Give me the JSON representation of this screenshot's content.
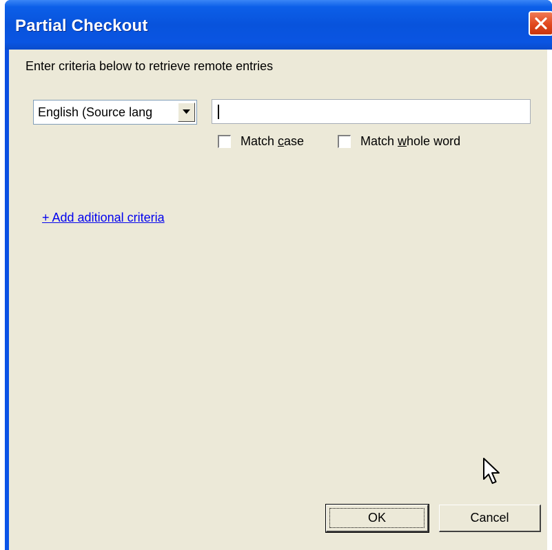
{
  "window": {
    "title": "Partial Checkout"
  },
  "dialog": {
    "instructions": "Enter criteria below to retrieve remote entries",
    "language_select": {
      "value": "English (Source lang"
    },
    "search": {
      "value": ""
    },
    "checkboxes": {
      "match_case": {
        "label_pre": "Match ",
        "mnemonic": "c",
        "label_post": "ase",
        "checked": false
      },
      "match_whole_word": {
        "label_pre": "Match ",
        "mnemonic": "w",
        "label_post": "hole word",
        "checked": false
      }
    },
    "add_criteria_link": "+ Add aditional criteria",
    "buttons": {
      "ok": "OK",
      "cancel": "Cancel"
    }
  },
  "colors": {
    "title_bar": "#0a54e2",
    "client_bg": "#ece9d8",
    "link": "#0000ee",
    "close_button": "#e1471d"
  },
  "icons": {
    "close": "close-icon",
    "dropdown": "chevron-down-icon",
    "cursor": "mouse-pointer-icon"
  }
}
